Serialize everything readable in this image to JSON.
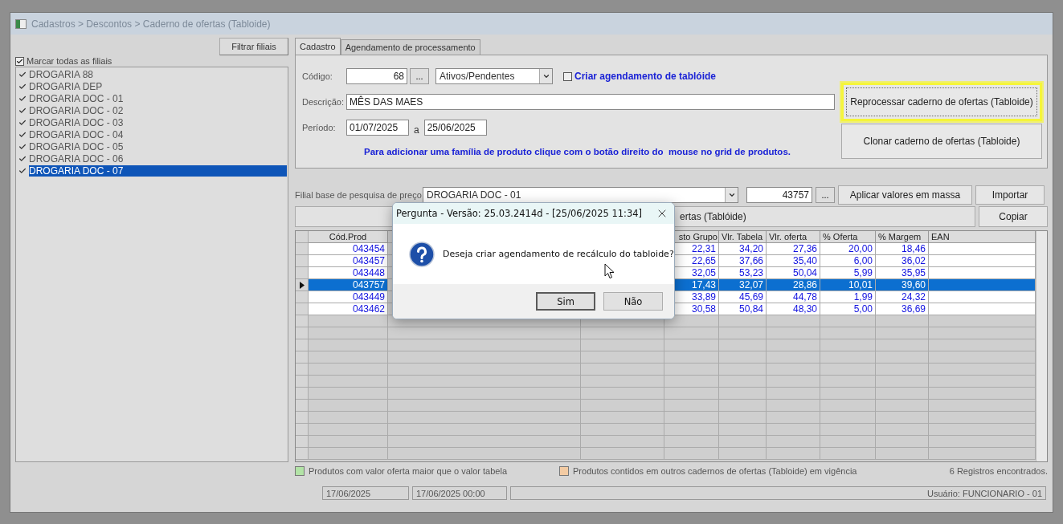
{
  "window": {
    "title": "Cadastros > Descontos > Caderno de ofertas (Tabloide)"
  },
  "branches": {
    "filter_button": "Filtrar filiais",
    "select_all": {
      "label": "Marcar todas as filiais",
      "checked": true
    },
    "items": [
      {
        "label": "DROGARIA 88",
        "checked": true,
        "selected": false
      },
      {
        "label": "DROGARIA DEP",
        "checked": true,
        "selected": false
      },
      {
        "label": "DROGARIA DOC - 01",
        "checked": true,
        "selected": false
      },
      {
        "label": "DROGARIA DOC - 02",
        "checked": true,
        "selected": false
      },
      {
        "label": "DROGARIA DOC - 03",
        "checked": true,
        "selected": false
      },
      {
        "label": "DROGARIA DOC - 04",
        "checked": true,
        "selected": false
      },
      {
        "label": "DROGARIA DOC - 05",
        "checked": true,
        "selected": false
      },
      {
        "label": "DROGARIA DOC - 06",
        "checked": true,
        "selected": false
      },
      {
        "label": "DROGARIA DOC - 07",
        "checked": true,
        "selected": true
      }
    ]
  },
  "tabs": [
    {
      "label": "Cadastro",
      "selected": true
    },
    {
      "label": "Agendamento de processamento",
      "selected": false
    }
  ],
  "form": {
    "code_label": "Código:",
    "code_value": "68",
    "lookup_button": "...",
    "status_select": "Ativos/Pendentes",
    "schedule": {
      "label": "Criar agendamento de tablóide",
      "checked": false
    },
    "description_label": "Descrição:",
    "description_value": "MÊS DAS MAES",
    "period_label": "Período:",
    "period_from": "01/07/2025",
    "period_sep": "a",
    "period_to": "25/06/2025",
    "note": "Para adicionar uma família de produto clique com o botão direito do  mouse no grid de produtos.",
    "reprocess_button": {
      "label": "Reprocessar caderno de ofertas (Tabloide)",
      "highlighted": true
    },
    "clone_button": "Clonar caderno de ofertas (Tabloide)"
  },
  "price_base": {
    "label": "Filial base de pesquisa de preço",
    "branch": "DROGARIA DOC - 01",
    "product": "43757",
    "lookup_button": "...",
    "apply_button": "Aplicar valores em massa",
    "import_button": "Importar",
    "process_button": "ertas (Tablóide)",
    "copy_button": "Copiar"
  },
  "table": {
    "columns": [
      "Cód.Prod",
      "sto Grupo",
      "Vlr. Tabela",
      "Vlr. oferta",
      "% Oferta",
      "% Margem",
      "EAN"
    ],
    "rows": [
      {
        "cells": [
          "043454",
          "22,31",
          "34,20",
          "27,36",
          "20,00",
          "18,46"
        ],
        "selected": false
      },
      {
        "cells": [
          "043457",
          "22,65",
          "37,66",
          "35,40",
          "6,00",
          "36,02"
        ],
        "selected": false
      },
      {
        "cells": [
          "043448",
          "32,05",
          "53,23",
          "50,04",
          "5,99",
          "35,95"
        ],
        "selected": false
      },
      {
        "cells": [
          "043757",
          "17,43",
          "32,07",
          "28,86",
          "10,01",
          "39,60"
        ],
        "selected": true
      },
      {
        "cells": [
          "043449",
          "33,89",
          "45,69",
          "44,78",
          "1,99",
          "24,32"
        ],
        "selected": false
      },
      {
        "cells": [
          "043462",
          "30,58",
          "50,84",
          "48,30",
          "5,00",
          "36,69"
        ],
        "selected": false
      }
    ]
  },
  "legend": [
    {
      "label": "Produtos com valor oferta maior que o valor tabela",
      "color": "#b2e3a6"
    },
    {
      "label": "Produtos contidos em outros cadernos de ofertas (Tabloide) em vigência",
      "color": "#f3cba3"
    }
  ],
  "record_count": "6 Registros encontrados.",
  "status_bar": [
    "17/06/2025",
    "17/06/2025 00:00",
    "Usuário: FUNCIONARIO - 01"
  ],
  "dialog": {
    "title": "Pergunta - Versão: 25.03.2414d - [25/06/2025 11:34]",
    "message": "Deseja criar agendamento de recálculo do tabloide?",
    "buttons": [
      {
        "label": "Sim",
        "default": true
      },
      {
        "label": "Não",
        "default": false
      }
    ]
  }
}
